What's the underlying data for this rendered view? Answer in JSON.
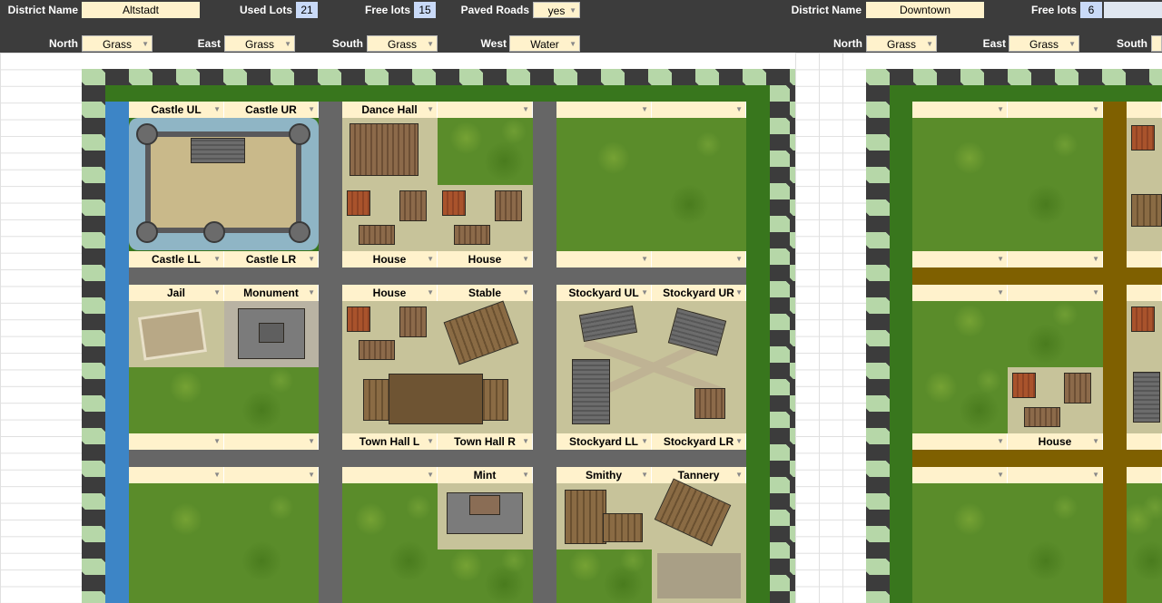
{
  "left_district": {
    "district_name_label": "District Name",
    "district_name": "Altstadt",
    "used_lots_label": "Used Lots",
    "used_lots": "21",
    "free_lots_label": "Free lots",
    "free_lots": "15",
    "paved_roads_label": "Paved Roads",
    "paved_roads": "yes",
    "north_label": "North",
    "north": "Grass",
    "east_label": "East",
    "east": "Grass",
    "south_label": "South",
    "south": "Grass",
    "west_label": "West",
    "west": "Water"
  },
  "right_district": {
    "district_name_label": "District Name",
    "district_name": "Downtown",
    "free_lots_label": "Free lots",
    "free_lots": "6",
    "north_label": "North",
    "north": "Grass",
    "east_label": "East",
    "east": "Grass",
    "south_label": "South"
  },
  "lots": {
    "row1": [
      "Castle UL",
      "Castle UR",
      "Dance Hall",
      "",
      "",
      ""
    ],
    "row2": [
      "Castle LL",
      "Castle LR",
      "House",
      "House",
      "",
      ""
    ],
    "row3": [
      "Jail",
      "Monument",
      "House",
      "Stable",
      "Stockyard UL",
      "Stockyard UR"
    ],
    "row4": [
      "",
      "",
      "Town Hall L",
      "Town Hall R",
      "Stockyard LL",
      "Stockyard LR"
    ],
    "row5": [
      "",
      "",
      "",
      "Mint",
      "Smithy",
      "Tannery"
    ]
  },
  "right_lots": {
    "r1": [
      "",
      ""
    ],
    "r2": [
      "",
      ""
    ],
    "r3": [
      "",
      ""
    ],
    "r4": [
      "",
      "House"
    ],
    "r5": [
      "",
      ""
    ]
  },
  "icons": [
    "dropdown-arrow-icon"
  ]
}
